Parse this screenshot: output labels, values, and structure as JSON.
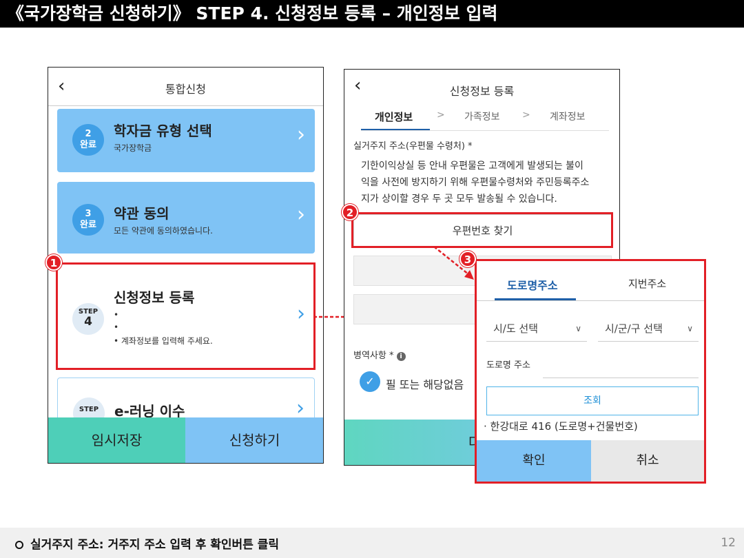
{
  "page_title": "《국가장학금 신청하기》 STEP 4. 신청정보 등록 – 개인정보 입력",
  "left_phone": {
    "back_icon": "chevron-left-icon",
    "header_title": "통합신청",
    "cards": [
      {
        "badge_num": "2",
        "badge_text": "완료",
        "title": "학자금 유형 선택",
        "subtitle": "국가장학금"
      },
      {
        "badge_num": "3",
        "badge_text": "완료",
        "title": "약관 동의",
        "subtitle": "모든 약관에 동의하였습니다."
      }
    ],
    "step4": {
      "badge_top": "STEP",
      "badge_num": "4",
      "title": "신청정보 등록",
      "bullets": [
        "•",
        "•",
        "• 계좌정보를 입력해 주세요."
      ]
    },
    "step5": {
      "badge_top": "STEP",
      "title": "e-러닝 이수"
    },
    "btn_temp_save": "임시저장",
    "btn_apply": "신청하기"
  },
  "middle_phone": {
    "header_title": "신청정보 등록",
    "tabs": [
      "개인정보",
      "가족정보",
      "계좌정보"
    ],
    "tab_sep": ">",
    "address_label": "실거주지 주소(우편물 수령처) *",
    "notice_lines": [
      "기한이익상실 등 안내 우편물은 고객에게 발생되는 불이",
      "익을 사전에 방지하기 위해 우편물수령처와 주민등록주소",
      "지가 상이할 경우 두 곳 모두 발송될 수 있습니다."
    ],
    "zip_button": "우편번호 찾기",
    "military_label": "병역사항 *",
    "military_check": "필 또는 해당없음",
    "bottom_fragment": "다"
  },
  "popup": {
    "tab_road": "도로명주소",
    "tab_lot": "지번주소",
    "select_city": "시/도 선택",
    "select_district": "시/군/구 선택",
    "road_label": "도로명 주소",
    "search_button": "조회",
    "example": "· 한강대로 416 (도로명+건물번호)",
    "confirm": "확인",
    "cancel": "취소"
  },
  "annotations": {
    "n1": "1",
    "n2": "2",
    "n3": "3"
  },
  "footer": {
    "text": "실거주지 주소: 거주지 주소 입력 후 확인버튼 클릭",
    "page": "12"
  },
  "colors": {
    "accent_blue": "#7fc3f5",
    "badge_blue": "#3f9fe6",
    "mint": "#4ecfb8",
    "highlight_red": "#e21f26"
  }
}
